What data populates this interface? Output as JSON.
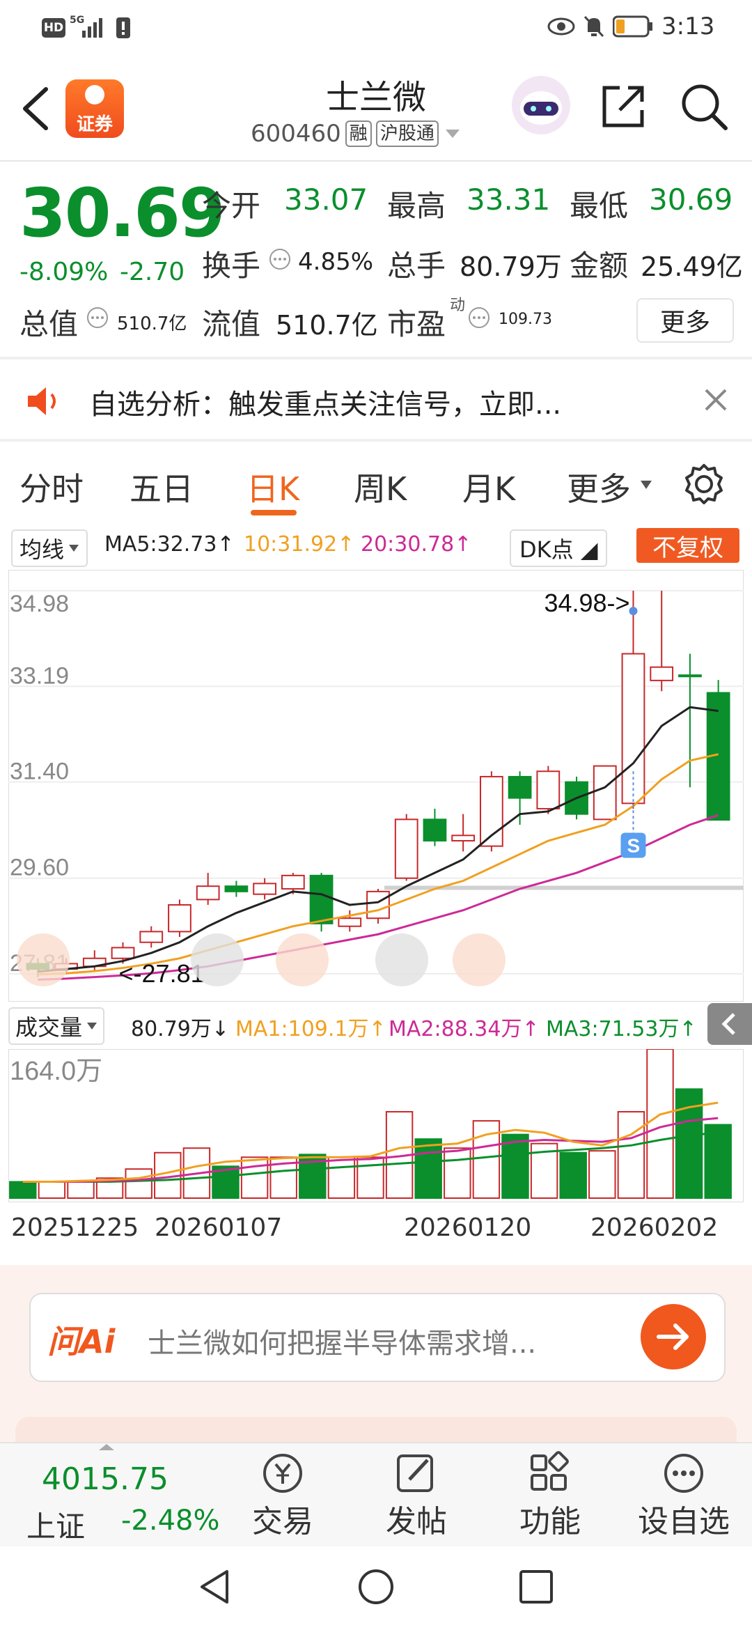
{
  "status": {
    "time": "3:13",
    "hd": "HD",
    "net": "5G"
  },
  "header": {
    "title": "士兰微",
    "code": "600460",
    "tag_margin": "融",
    "tag_connect": "沪股通",
    "brand_label": "证券"
  },
  "quote": {
    "price": "30.69",
    "change_pct": "-8.09%",
    "change": "-2.70",
    "open_label": "今开",
    "open": "33.07",
    "high_label": "最高",
    "high": "33.31",
    "low_label": "最低",
    "low": "30.69",
    "turnover_label": "换手",
    "turnover": "4.85%",
    "volume_label": "总手",
    "volume": "80.79万",
    "amount_label": "金额",
    "amount": "25.49亿",
    "mktcap_label": "总值",
    "mktcap": "510.7亿",
    "float_label": "流值",
    "float": "510.7亿",
    "pe_label": "市盈",
    "pe_sup": "动",
    "pe": "109.73",
    "more_label": "更多"
  },
  "banner": {
    "text": "自选分析：触发重点关注信号，立即..."
  },
  "tabs": [
    "分时",
    "五日",
    "日K",
    "周K",
    "月K",
    "更多"
  ],
  "active_tab": "日K",
  "ma_bar": {
    "select": "均线",
    "ma5": "MA5:32.73↑",
    "ma10": "10:31.92↑",
    "ma20": "20:30.78↑",
    "dk": "DK点",
    "fq": "不复权"
  },
  "chart_data": {
    "type": "candlestick",
    "y_ticks": [
      "34.98",
      "33.19",
      "31.40",
      "29.60",
      "27.81"
    ],
    "ylim": [
      27.81,
      34.98
    ],
    "high_marker": "34.98->",
    "low_marker": "<-27.81",
    "signal_marker": "S",
    "candles": [
      {
        "o": 28.0,
        "c": 27.9,
        "h": 28.1,
        "l": 27.75
      },
      {
        "o": 27.9,
        "c": 28.0,
        "h": 28.1,
        "l": 27.8
      },
      {
        "o": 27.95,
        "c": 28.1,
        "h": 28.25,
        "l": 27.85
      },
      {
        "o": 28.1,
        "c": 28.3,
        "h": 28.4,
        "l": 28.0
      },
      {
        "o": 28.4,
        "c": 28.6,
        "h": 28.7,
        "l": 28.3
      },
      {
        "o": 28.6,
        "c": 29.1,
        "h": 29.2,
        "l": 28.5
      },
      {
        "o": 29.2,
        "c": 29.45,
        "h": 29.7,
        "l": 29.1
      },
      {
        "o": 29.45,
        "c": 29.35,
        "h": 29.55,
        "l": 29.25
      },
      {
        "o": 29.3,
        "c": 29.5,
        "h": 29.6,
        "l": 29.2
      },
      {
        "o": 29.4,
        "c": 29.65,
        "h": 29.7,
        "l": 29.3
      },
      {
        "o": 29.65,
        "c": 28.75,
        "h": 29.7,
        "l": 28.6
      },
      {
        "o": 28.7,
        "c": 28.85,
        "h": 29.0,
        "l": 28.6
      },
      {
        "o": 28.85,
        "c": 29.35,
        "h": 29.4,
        "l": 28.75
      },
      {
        "o": 29.6,
        "c": 30.7,
        "h": 30.8,
        "l": 29.55
      },
      {
        "o": 30.7,
        "c": 30.3,
        "h": 30.9,
        "l": 30.2
      },
      {
        "o": 30.3,
        "c": 30.4,
        "h": 30.8,
        "l": 30.1
      },
      {
        "o": 30.2,
        "c": 31.5,
        "h": 31.6,
        "l": 30.1
      },
      {
        "o": 31.5,
        "c": 31.1,
        "h": 31.6,
        "l": 30.6
      },
      {
        "o": 30.9,
        "c": 31.6,
        "h": 31.7,
        "l": 30.8
      },
      {
        "o": 31.4,
        "c": 30.8,
        "h": 31.5,
        "l": 30.7
      },
      {
        "o": 30.7,
        "c": 31.7,
        "h": 31.7,
        "l": 30.7
      },
      {
        "o": 31.0,
        "c": 33.8,
        "h": 34.98,
        "l": 30.9
      },
      {
        "o": 33.3,
        "c": 33.55,
        "h": 34.98,
        "l": 33.1
      },
      {
        "o": 33.4,
        "c": 33.38,
        "h": 33.8,
        "l": 31.3
      },
      {
        "o": 33.07,
        "c": 30.69,
        "h": 33.31,
        "l": 30.69
      }
    ],
    "ma5": [
      27.85,
      27.9,
      27.95,
      28.05,
      28.2,
      28.4,
      28.7,
      28.95,
      29.15,
      29.35,
      29.3,
      29.1,
      29.15,
      29.45,
      29.7,
      29.95,
      30.4,
      30.8,
      30.85,
      31.1,
      31.3,
      31.75,
      32.45,
      32.8,
      32.73
    ],
    "ma10": [
      27.8,
      27.82,
      27.86,
      27.92,
      28.0,
      28.1,
      28.25,
      28.4,
      28.55,
      28.7,
      28.8,
      28.9,
      29.0,
      29.2,
      29.4,
      29.55,
      29.8,
      30.05,
      30.3,
      30.45,
      30.6,
      30.95,
      31.45,
      31.8,
      31.92
    ],
    "ma20": [
      27.7,
      27.72,
      27.75,
      27.78,
      27.82,
      27.88,
      27.95,
      28.05,
      28.15,
      28.25,
      28.35,
      28.45,
      28.55,
      28.7,
      28.85,
      29.0,
      29.2,
      29.4,
      29.55,
      29.7,
      29.9,
      30.1,
      30.35,
      30.6,
      30.78
    ],
    "volume_max_label": "164.0万",
    "volumes": [
      18,
      18,
      18,
      22,
      32,
      50,
      55,
      35,
      45,
      45,
      48,
      45,
      45,
      95,
      65,
      55,
      85,
      70,
      60,
      50,
      52,
      95,
      164,
      120,
      80.79
    ],
    "vol_ma1": [
      18,
      18,
      19,
      20,
      22,
      28,
      35,
      40,
      42,
      44,
      45,
      45,
      46,
      55,
      58,
      60,
      70,
      75,
      72,
      62,
      58,
      70,
      92,
      100,
      105
    ],
    "vol_ma2": [
      18,
      18,
      18,
      19,
      20,
      23,
      27,
      31,
      35,
      38,
      40,
      42,
      43,
      46,
      50,
      52,
      57,
      62,
      64,
      63,
      62,
      66,
      78,
      85,
      88
    ],
    "vol_ma3": [
      18,
      18,
      18,
      18,
      19,
      20,
      22,
      24,
      27,
      30,
      32,
      34,
      36,
      38,
      40,
      42,
      45,
      48,
      51,
      53,
      55,
      58,
      64,
      69,
      72
    ],
    "x_labels": [
      "20251225",
      "20260107",
      "20260120",
      "20260202"
    ]
  },
  "vol_bar": {
    "select": "成交量",
    "vol": "80.79万↓",
    "ma1": "MA1:109.1万↑",
    "ma2": "MA2:88.34万↑",
    "ma3": "MA3:71.53万↑"
  },
  "ai": {
    "brand": "问Ai",
    "prompt": "士兰微如何把握半导体需求增..."
  },
  "bottom_nav": {
    "index_value": "4015.75",
    "index_name": "上证",
    "index_change": "-2.48%",
    "items": [
      "交易",
      "发帖",
      "功能",
      "设自选"
    ]
  },
  "colors": {
    "up": "#c8282a",
    "down": "#0a8f2c",
    "accent": "#f0651e",
    "ma5": "#222222",
    "ma10": "#f0a020",
    "ma20": "#cc2a96"
  }
}
